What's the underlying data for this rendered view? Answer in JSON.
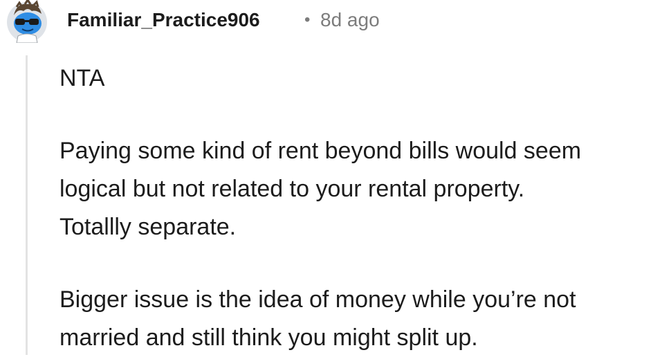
{
  "comment": {
    "author": "Familiar_Practice906",
    "separator": "•",
    "age": "8d ago",
    "paragraphs": [
      [
        "NTA"
      ],
      [
        "Paying some kind of rent beyond bills would seem",
        "logical but not related to your rental property.",
        "Totallly separate."
      ],
      [
        "Bigger issue is the idea of money while you’re not",
        "married and still think you might split up."
      ]
    ]
  },
  "colors": {
    "text": "#1c1c1c",
    "meta": "#7c7c7c",
    "thread_line": "#e3e3e3",
    "avatar_bg": "#dfe3e8",
    "avatar_glasses": "#1a1a1a",
    "avatar_accent": "#2f8de4"
  },
  "icons": {
    "avatar": "snoo-avatar-with-sunglasses"
  }
}
